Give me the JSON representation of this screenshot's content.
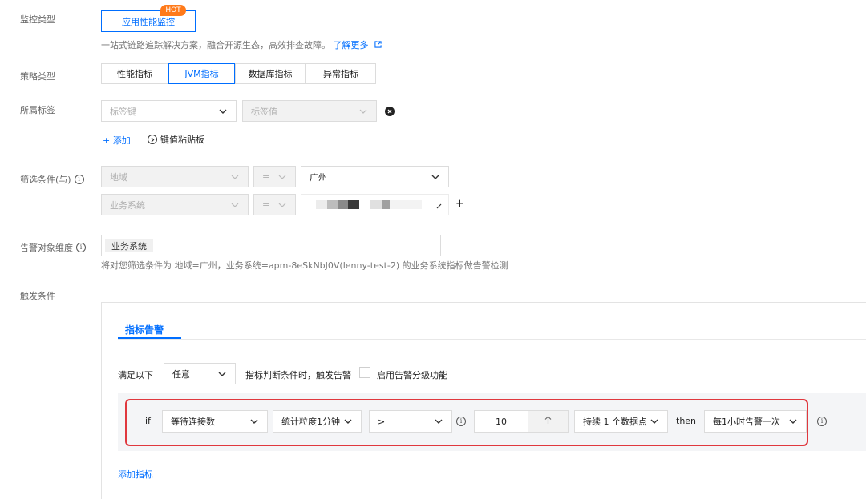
{
  "form": {
    "monitor_type": {
      "label": "监控类型",
      "option": "应用性能监控",
      "badge": "HOT",
      "desc": "一站式链路追踪解决方案，融合开源生态，高效排查故障。",
      "learn_more": "了解更多",
      "link_icon": "external-link-icon"
    },
    "policy_type": {
      "label": "策略类型",
      "tabs": [
        "性能指标",
        "JVM指标",
        "数据库指标",
        "异常指标"
      ],
      "active_index": 1
    },
    "tags": {
      "label": "所属标签",
      "key_placeholder": "标签键",
      "value_placeholder": "标签值",
      "add": "+ 添加",
      "clipboard": "键值粘贴板"
    },
    "filter": {
      "label": "筛选条件(与)",
      "rows": [
        {
          "field": "地域",
          "op": "=",
          "value": "广州"
        },
        {
          "field": "业务系统",
          "op": "=",
          "value": ""
        }
      ],
      "add_symbol": "+"
    },
    "alarm_dim": {
      "label": "告警对象维度",
      "chip": "业务系统",
      "desc": "将对您筛选条件为 地域=广州，业务系统=apm-8eSkNbJ0V(lenny-test-2) 的业务系统指标做告警检测"
    },
    "trigger": {
      "label": "触发条件",
      "tab": "指标告警",
      "satisfy_prefix": "满足以下",
      "satisfy_value": "任意",
      "satisfy_suffix": "指标判断条件时，触发告警",
      "grade_label": "启用告警分级功能",
      "rule": {
        "if_label": "if",
        "metric": "等待连接数",
        "granularity": "统计粒度1分钟",
        "operator": ">",
        "threshold": "10",
        "stepper_icon": "arrow-up-icon",
        "duration": "持续 1 个数据点",
        "then_label": "then",
        "frequency": "每1小时告警一次"
      },
      "add_metric": "添加指标"
    }
  },
  "colors": {
    "accent": "#006eff",
    "hot_badge": "#ff7a1a",
    "highlight_border": "#e0383e",
    "rule_bg": "#f4f5f7"
  }
}
